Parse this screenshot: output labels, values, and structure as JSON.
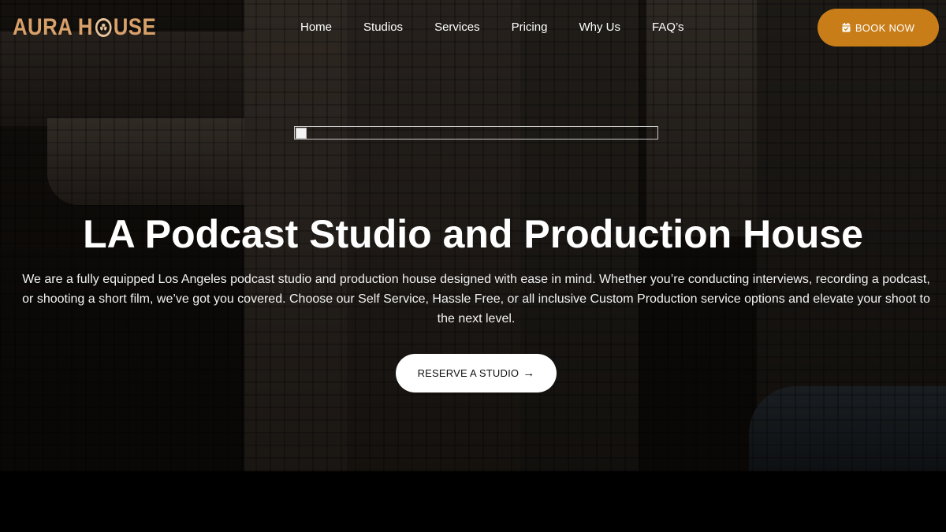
{
  "brand": {
    "logo_left": "AURA H",
    "logo_right": "USE",
    "logo_color": "#d8a06a"
  },
  "nav": {
    "items": [
      {
        "label": "Home"
      },
      {
        "label": "Studios"
      },
      {
        "label": "Services"
      },
      {
        "label": "Pricing"
      },
      {
        "label": "Why Us"
      },
      {
        "label": "FAQ’s"
      }
    ]
  },
  "header": {
    "book_label": "BOOK NOW",
    "book_icon": "calendar-check-icon",
    "book_color": "#c97d18"
  },
  "hero": {
    "headline": "LA Podcast Studio and Production House",
    "intro": "We are a fully equipped Los Angeles podcast studio and production house designed with ease in mind. Whether you’re conducting interviews, recording a podcast, or shooting a short film, we’ve got you covered. Choose our Self Service, Hassle Free, or all inclusive Custom Production service options and elevate your shoot to the next level.",
    "cta_label": "RESERVE A STUDIO",
    "cta_icon": "arrow-right-icon",
    "cta_arrow": "→"
  }
}
